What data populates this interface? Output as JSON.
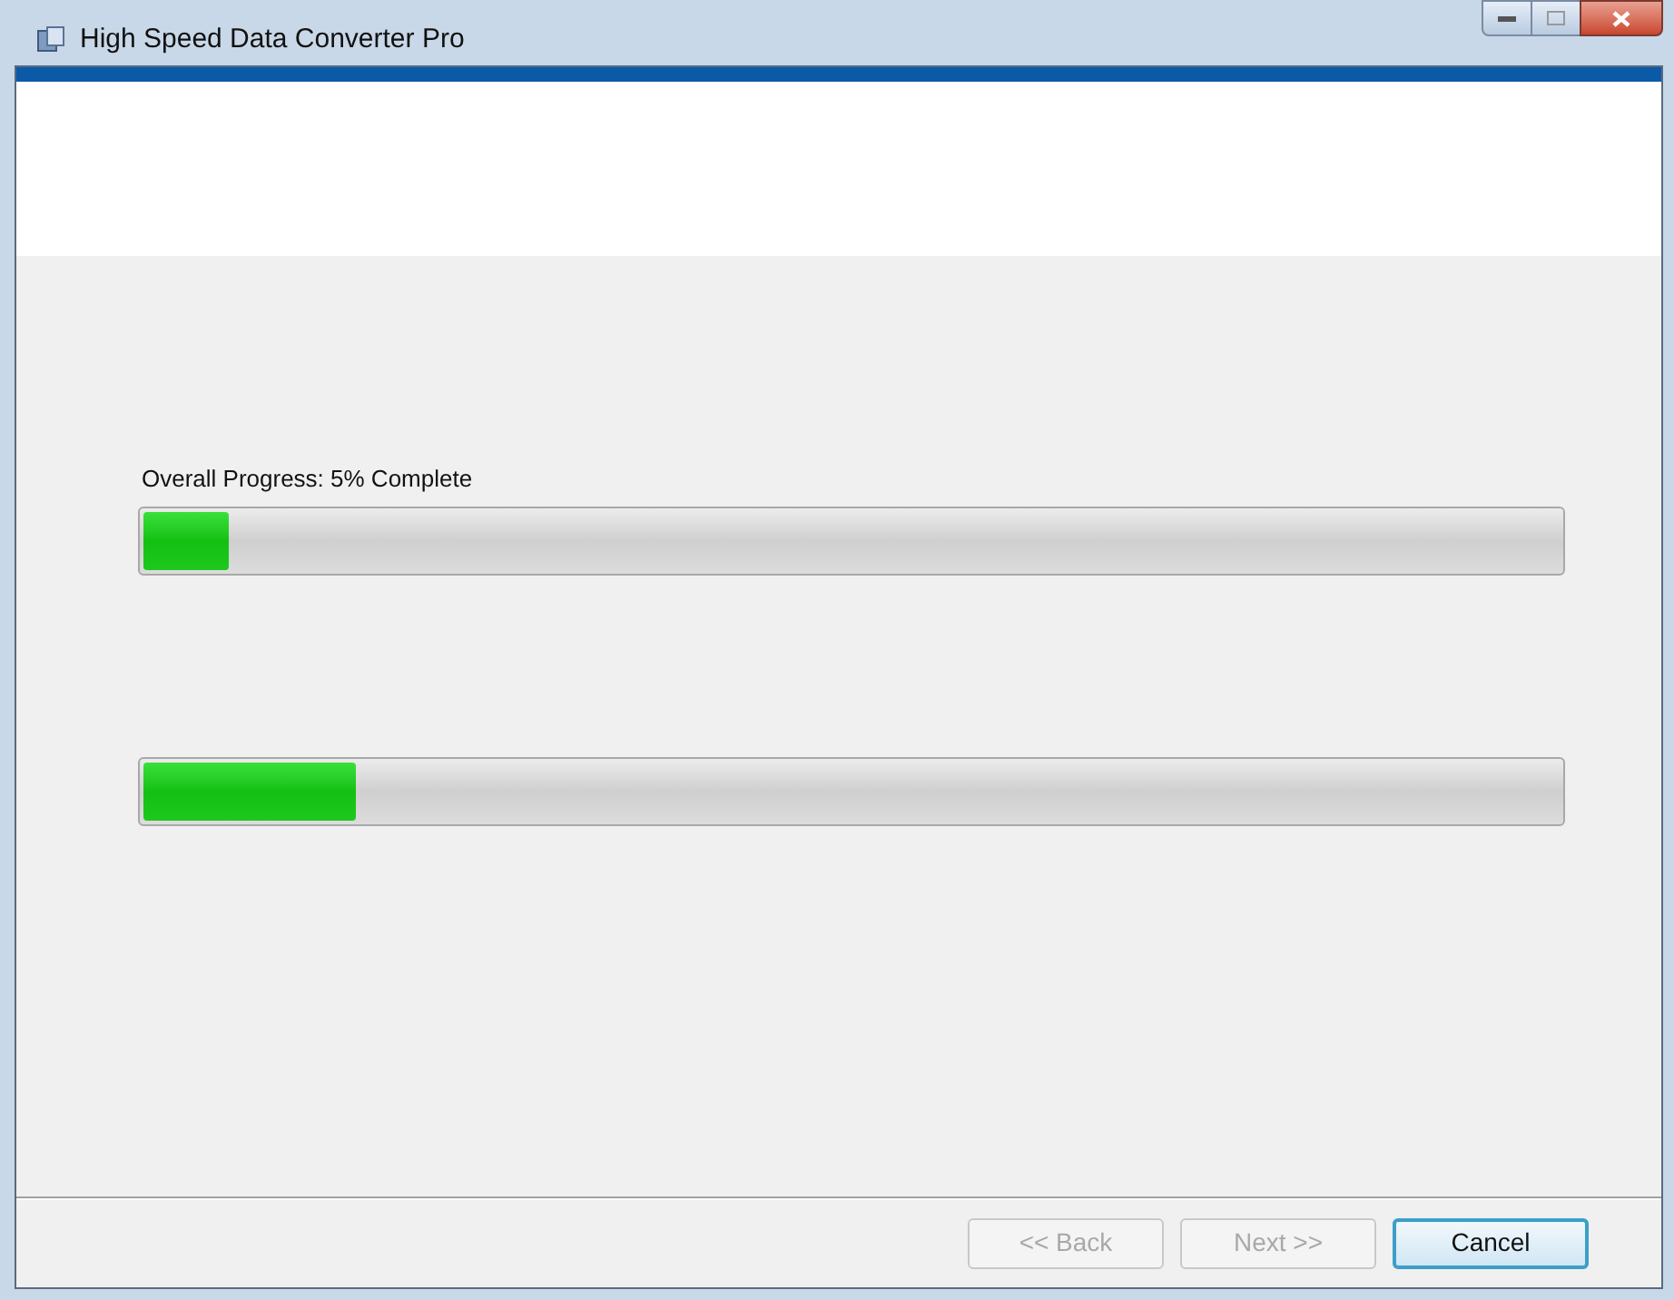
{
  "window": {
    "title": "High Speed Data Converter Pro"
  },
  "progress_bars": [
    {
      "label": "Overall Progress: 5% Complete",
      "level": 0.06
    },
    {
      "level": 0.15
    }
  ],
  "buttons": [
    {
      "label": "<< Back",
      "disabled": true,
      "default": false
    },
    {
      "label": "Next >>",
      "disabled": true,
      "default": false
    },
    {
      "label": "Cancel",
      "disabled": false,
      "default": true
    }
  ]
}
